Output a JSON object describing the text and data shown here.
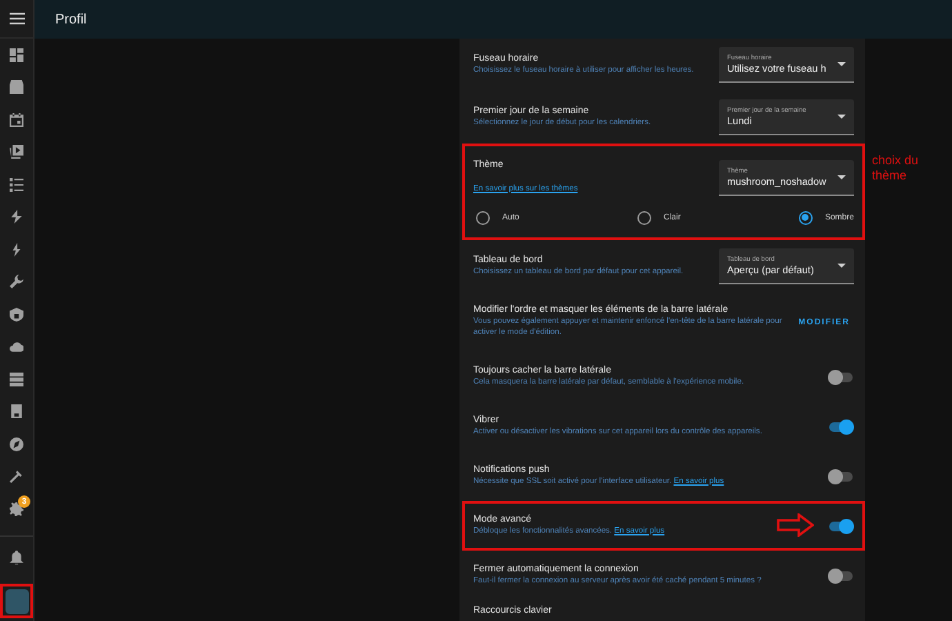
{
  "header": {
    "title": "Profil"
  },
  "sidebar": {
    "badge": "3",
    "avatar_highlighted": true
  },
  "rows": [
    {
      "kind": "select",
      "title": "Fuseau horaire",
      "description": "Choisissez le fuseau horaire à utiliser pour afficher les heures.",
      "select": {
        "label": "Fuseau horaire",
        "value": "Utilisez votre fuseau h"
      }
    },
    {
      "kind": "select",
      "title": "Premier jour de la semaine",
      "description": "Sélectionnez le jour de début pour les calendriers.",
      "select": {
        "label": "Premier jour de la semaine",
        "value": "Lundi"
      }
    },
    {
      "kind": "theme",
      "title": "Thème",
      "link": "En savoir plus sur les thèmes",
      "select": {
        "label": "Thème",
        "value": "mushroom_noshadow"
      },
      "options": [
        {
          "label": "Auto",
          "selected": false
        },
        {
          "label": "Clair",
          "selected": false
        },
        {
          "label": "Sombre",
          "selected": true
        }
      ],
      "highlighted": true,
      "note": "choix du thème"
    },
    {
      "kind": "select",
      "title": "Tableau de bord",
      "description": "Choisissez un tableau de bord par défaut pour cet appareil.",
      "select": {
        "label": "Tableau de bord",
        "value": "Aperçu (par défaut)"
      }
    },
    {
      "kind": "button",
      "title": "Modifier l'ordre et masquer les éléments de la barre latérale",
      "description": "Vous pouvez également appuyer et maintenir enfoncé l'en-tête de la barre latérale pour activer le mode d'édition.",
      "button": "MODIFIER"
    },
    {
      "kind": "toggle",
      "title": "Toujours cacher la barre latérale",
      "description": "Cela masquera la barre latérale par défaut, semblable à l'expérience mobile.",
      "on": false
    },
    {
      "kind": "toggle",
      "title": "Vibrer",
      "description": "Activer ou désactiver les vibrations sur cet appareil lors du contrôle des appareils.",
      "on": true
    },
    {
      "kind": "toggle",
      "title": "Notifications push",
      "description": "Nécessite que SSL soit activé pour l'interface utilisateur.",
      "link": "En savoir plus",
      "on": false
    },
    {
      "kind": "toggle",
      "title": "Mode avancé",
      "description": "Débloque les fonctionnalités avancées.",
      "link": "En savoir plus",
      "on": true,
      "highlighted": true,
      "arrow": true
    },
    {
      "kind": "toggle",
      "title": "Fermer automatiquement la connexion",
      "description": "Faut-il fermer la connexion au serveur après avoir été caché pendant 5 minutes ?",
      "on": false
    },
    {
      "kind": "heading",
      "title": "Raccourcis clavier"
    }
  ]
}
